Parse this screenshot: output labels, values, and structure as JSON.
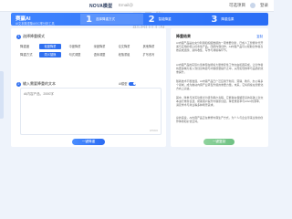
{
  "topbar": {
    "brand": "NOVA模型",
    "brand_sub": "Email@",
    "links": [
      "可选项目",
      "登录"
    ]
  },
  "watermark": {
    "line1": "AI工具集",
    "line2": "AI-BOT.CN"
  },
  "header": {
    "title": "赛赢AI",
    "subtitle": "AI文本降重降AIGC率分析工具",
    "steps": [
      {
        "num": "1",
        "label": "选择降重方式"
      },
      {
        "num": "2",
        "label": "智能降重"
      },
      {
        "num": "3",
        "label": "降重结果"
      }
    ]
  },
  "left": {
    "section1_badge": "1",
    "section1_title": "选择降重模式",
    "rows": [
      {
        "label": "降重度",
        "options": [
          "轻度降重",
          "中度降重",
          "深度降重",
          "论文降重",
          "其他降重"
        ]
      },
      {
        "label": "降重方式",
        "options": [
          "同义替换",
          "句式调整",
          "语序调整",
          "段落重组",
          "扩写改写"
        ]
      }
    ],
    "section2_badge": "2",
    "section2_title": "输入需要降重的文本",
    "model_label": "AI模型",
    "textarea_text": "AI内容产品，2000字",
    "counter": "0/5000",
    "button": "一键降重"
  },
  "right": {
    "title": "降重结果",
    "action": "复制",
    "paragraphs": [
      "AI内容产品是在充分利用和挖掘数据的一项重要创新，已成人工智能时代开发与应用的核心标志性产品。围绕内容创作，AI内容产品可以帮助创作者高效完成选题、资料收集、写作与排版等环节。",
      "AI内容产品的实际价值体现在能将大量重复性工作交由机器完成，让创作者将更多精力投入到创意构思与内容质量提升之中，从而实现效率与品质的双重提升。",
      "随着技术不断发展，AI内容产品已广泛应用于新闻、营销、教育、办公等多个领域，成为推动内容产业转型升级的重要力量。未来，它将持续在智能化方向上演进。",
      "其中，降重与改写功能尤为受到用户青睐，它能够在保留原意的基础上对文本进行重新表述，帮助用户提升内容原创度，降低重复率与AIGC检测率，满足学术与商业等多种场景需求。",
      "总的来说，AI内容产品正在重塑内容生产方式，为个人与企业带来全新的创作体验和价值空间。"
    ],
    "button": "一键复制"
  }
}
